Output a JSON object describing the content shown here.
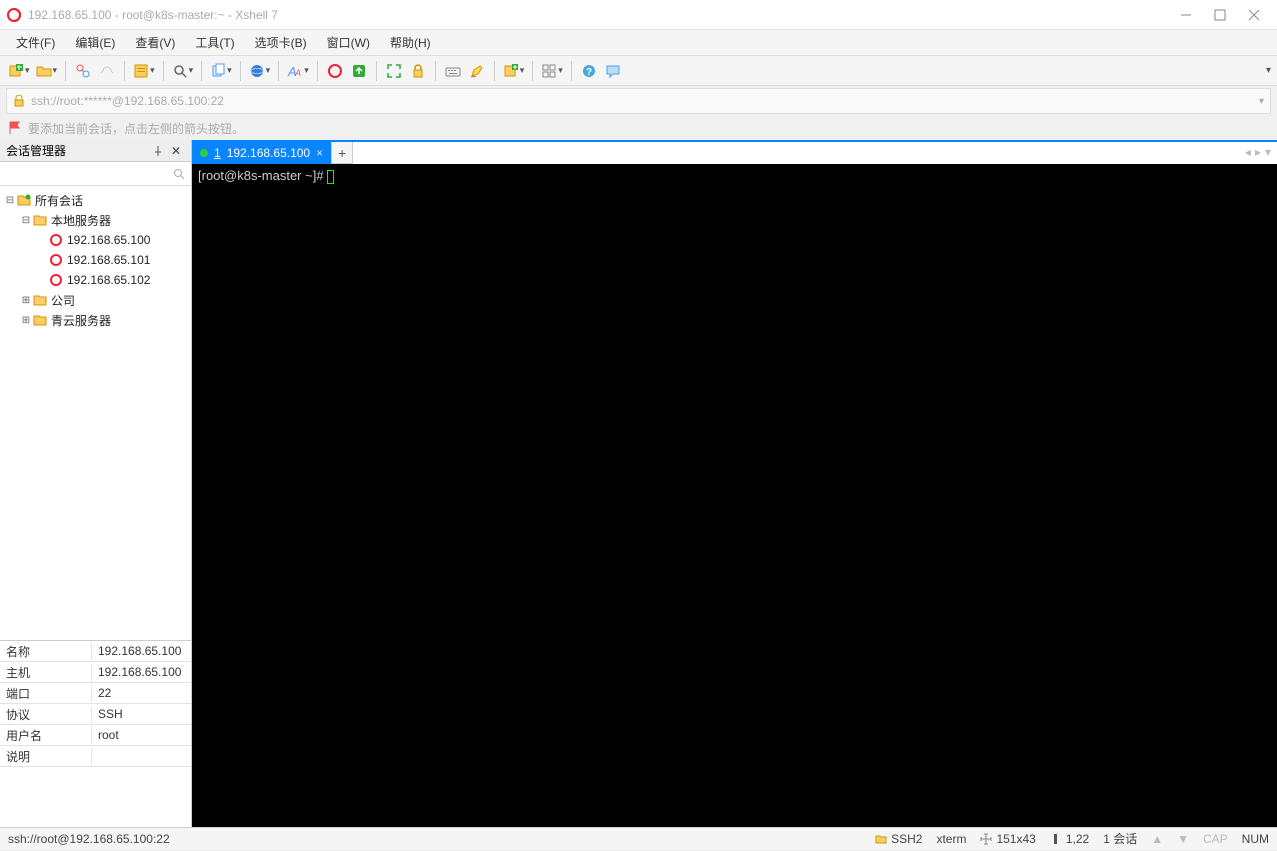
{
  "window": {
    "title": "192.168.65.100 - root@k8s-master:~ - Xshell 7"
  },
  "menu": {
    "file": "文件(F)",
    "edit": "编辑(E)",
    "view": "查看(V)",
    "tools": "工具(T)",
    "tab": "选项卡(B)",
    "window": "窗口(W)",
    "help": "帮助(H)"
  },
  "address": {
    "url": "ssh://root:******@192.168.65.100:22"
  },
  "hint": {
    "text": "要添加当前会话，点击左侧的箭头按钮。"
  },
  "sidebar": {
    "title": "会话管理器",
    "search_placeholder": "",
    "root": "所有会话",
    "folder_local": "本地服务器",
    "hosts": [
      "192.168.65.100",
      "192.168.65.101",
      "192.168.65.102"
    ],
    "folder_company": "公司",
    "folder_qingyun": "青云服务器"
  },
  "props": {
    "name_k": "名称",
    "name_v": "192.168.65.100",
    "host_k": "主机",
    "host_v": "192.168.65.100",
    "port_k": "端口",
    "port_v": "22",
    "proto_k": "协议",
    "proto_v": "SSH",
    "user_k": "用户名",
    "user_v": "root",
    "desc_k": "说明",
    "desc_v": ""
  },
  "tab": {
    "index": "1",
    "label": "192.168.65.100"
  },
  "terminal": {
    "prompt": "[root@k8s-master ~]# "
  },
  "status": {
    "left": "ssh://root@192.168.65.100:22",
    "ssh": "SSH2",
    "term": "xterm",
    "size": "151x43",
    "pos": "1,22",
    "sessions": "1 会话",
    "cap": "CAP",
    "num": "NUM"
  }
}
